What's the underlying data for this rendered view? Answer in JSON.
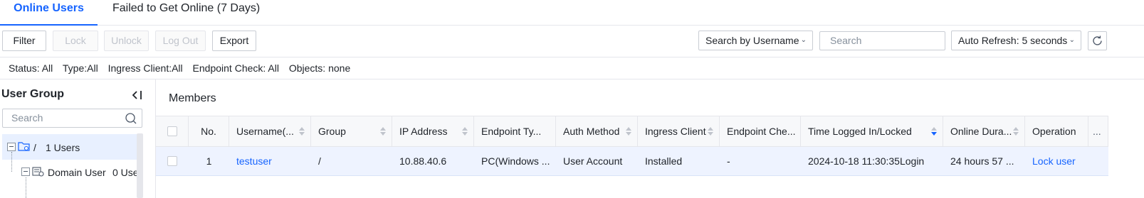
{
  "tabs": [
    {
      "label": "Online Users",
      "active": true
    },
    {
      "label": "Failed to Get Online (7 Days)",
      "active": false
    }
  ],
  "toolbar": {
    "filter": "Filter",
    "lock": "Lock",
    "unlock": "Unlock",
    "logout": "Log Out",
    "export": "Export",
    "search_by": "Search by Username",
    "search_placeholder": "Search",
    "auto_refresh": "Auto Refresh: 5 seconds"
  },
  "filters": {
    "status": "Status: All",
    "type": "Type:All",
    "ingress": "Ingress Client:All",
    "endpoint": "Endpoint Check: All",
    "objects": "Objects: none"
  },
  "left_panel": {
    "title": "User Group",
    "search_placeholder": "Search",
    "tree": [
      {
        "name": "/",
        "count": "1 Users"
      },
      {
        "name": "Domain User",
        "count": "0 Use"
      }
    ]
  },
  "main": {
    "title": "Members",
    "columns": [
      "No.",
      "Username(...",
      "Group",
      "IP Address",
      "Endpoint Ty...",
      "Auth Method",
      "Ingress Client",
      "Endpoint Che...",
      "Time Logged In/Locked",
      "Online Dura...",
      "Operation",
      "..."
    ],
    "rows": [
      {
        "no": "1",
        "username": "testuser",
        "group": "/",
        "ip": "10.88.40.6",
        "endpoint_type": "PC(Windows ...",
        "auth_method": "User Account",
        "ingress_client": "Installed",
        "endpoint_check": "-",
        "time_logged": "2024-10-18 11:30:35Login",
        "online_duration": "24 hours 57 ...",
        "operation": "Lock user"
      }
    ]
  },
  "colors": {
    "accent": "#1664ff",
    "selected_row": "#eef3ff",
    "header_bg": "#f7f8fa",
    "border": "#e5e6eb"
  }
}
